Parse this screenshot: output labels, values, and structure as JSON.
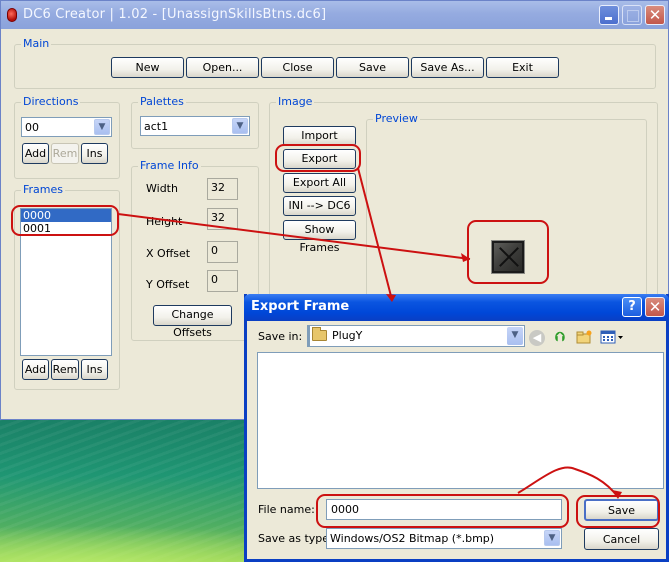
{
  "main_window": {
    "title": "DC6 Creator  |  1.02 - [UnassignSkillsBtns.dc6]",
    "controls": {
      "minimize": "minimize",
      "maximize": "maximize",
      "close": "✕"
    },
    "main_group": {
      "label": "Main",
      "buttons": [
        "New",
        "Open...",
        "Close",
        "Save",
        "Save As...",
        "Exit"
      ]
    },
    "directions": {
      "label": "Directions",
      "selected": "00",
      "buttons": {
        "add": "Add",
        "rem": "Rem",
        "ins": "Ins"
      },
      "rem_disabled": true
    },
    "palettes": {
      "label": "Palettes",
      "selected": "act1"
    },
    "frame_info": {
      "label": "Frame Info",
      "width_label": "Width",
      "width": "32",
      "height_label": "Height",
      "height": "32",
      "x_offset_label": "X Offset",
      "x_offset": "0",
      "y_offset_label": "Y Offset",
      "y_offset": "0",
      "change_offsets": "Change Offsets"
    },
    "frames": {
      "label": "Frames",
      "items": [
        "0000",
        "0001"
      ],
      "selected_index": 0,
      "buttons": {
        "add": "Add",
        "rem": "Rem",
        "ins": "Ins"
      }
    },
    "image": {
      "label": "Image",
      "buttons": {
        "import": "Import",
        "export": "Export",
        "export_all": "Export All",
        "ini_dc6": "INI --> DC6",
        "show_frames": "Show Frames"
      },
      "preview_label": "Preview"
    }
  },
  "dialog": {
    "title": "Export Frame",
    "help": "?",
    "close": "✕",
    "save_in_label": "Save in:",
    "save_in_value": "PlugY",
    "toolbar_icons": [
      "back-icon",
      "up-folder-icon",
      "new-folder-icon",
      "views-menu-icon"
    ],
    "file_name_label": "File name:",
    "file_name_value": "0000",
    "save_as_type_label": "Save as type:",
    "save_as_type_value": "Windows/OS2 Bitmap (*.bmp)",
    "save_button": "Save",
    "cancel_button": "Cancel"
  },
  "annotation_color": "#cc1111"
}
